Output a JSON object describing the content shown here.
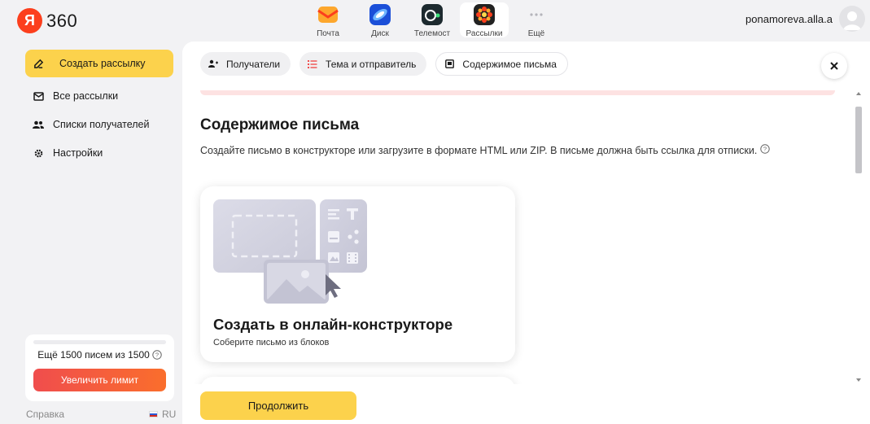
{
  "header": {
    "logo_ya": "Я",
    "logo_text": "360",
    "apps": [
      {
        "label": "Почта",
        "icon": "mail-icon"
      },
      {
        "label": "Диск",
        "icon": "disk-icon"
      },
      {
        "label": "Телемост",
        "icon": "telemost-icon"
      },
      {
        "label": "Рассылки",
        "icon": "mailings-icon",
        "active": true
      },
      {
        "label": "Ещё",
        "icon": "more-icon"
      }
    ],
    "username": "ponamoreva.alla.a"
  },
  "sidebar": {
    "items": [
      {
        "label": "Создать рассылку",
        "icon": "edit-icon"
      },
      {
        "label": "Все рассылки",
        "icon": "envelope-icon"
      },
      {
        "label": "Списки получателей",
        "icon": "people-icon"
      },
      {
        "label": "Настройки",
        "icon": "gear-icon"
      }
    ],
    "limit_text": "Ещё 1500 писем из 1500",
    "limit_button": "Увеличить лимит",
    "help": "Справка",
    "lang": "RU"
  },
  "steps": [
    {
      "label": "Получатели",
      "icon": "person-add-icon"
    },
    {
      "label": "Тема и отправитель",
      "icon": "list-icon"
    },
    {
      "label": "Содержимое письма",
      "icon": "document-icon"
    }
  ],
  "main": {
    "heading": "Содержимое письма",
    "description": "Создайте письмо в конструкторе или загрузите в формате HTML или ZIP. В письме должна быть ссылка для отписки.",
    "card_title": "Создать в онлайн-конструкторе",
    "card_subtitle": "Соберите письмо из блоков",
    "continue_button": "Продолжить"
  },
  "colors": {
    "accent_yellow": "#fcd24c",
    "limit_gradient_start": "#f04d4d",
    "limit_gradient_end": "#fa6e2c",
    "brand_red": "#fc3f1d"
  }
}
